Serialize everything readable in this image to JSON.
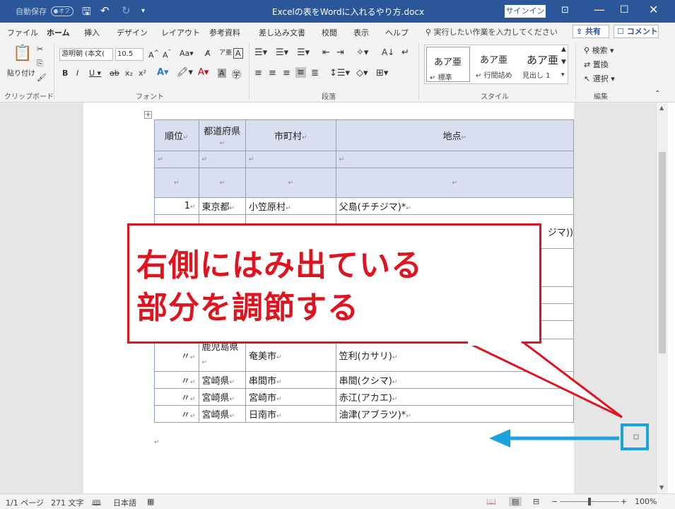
{
  "titlebar": {
    "autosave_label": "自動保存",
    "autosave_state": "オフ",
    "doc_title": "Excelの表をWordに入れるやり方.docx",
    "signin": "サインイン"
  },
  "tabs": [
    "ファイル",
    "ホーム",
    "挿入",
    "デザイン",
    "レイアウト",
    "参考資料",
    "差し込み文書",
    "校閲",
    "表示",
    "ヘルプ"
  ],
  "active_tab": "ホーム",
  "tellme": "実行したい作業を入力してください",
  "share": "共有",
  "comment": "コメント",
  "ribbon": {
    "clipboard": {
      "paste": "貼り付け",
      "label": "クリップボード"
    },
    "font": {
      "name": "游明朝 (本文(",
      "size": "10.5",
      "label": "フォント"
    },
    "paragraph": {
      "label": "段落"
    },
    "styles": {
      "label": "スタイル",
      "items": [
        {
          "preview": "あア亜",
          "name": "標準"
        },
        {
          "preview": "あア亜",
          "name": "行間詰め"
        },
        {
          "preview": "あア亜",
          "name": "見出し 1"
        }
      ]
    },
    "editing": {
      "find": "検索",
      "replace": "置換",
      "select": "選択",
      "label": "編集"
    }
  },
  "table": {
    "headers": [
      "順位",
      "都道府県",
      "市町村",
      "地点"
    ],
    "rows": [
      [
        "1",
        "東京都",
        "小笠原村",
        "父島(チチジマ)*"
      ],
      [
        "〃",
        "鹿児島県",
        "奄美市",
        "笠利(カサリ)"
      ],
      [
        "〃",
        "宮崎県",
        "串間市",
        "串間(クシマ)"
      ],
      [
        "〃",
        "宮崎県",
        "宮崎市",
        "赤江(アカエ)"
      ],
      [
        "〃",
        "宮崎県",
        "日南市",
        "油津(アブラツ)*"
      ]
    ],
    "partial_text": "ジマ))"
  },
  "callout": {
    "line1": "右側にはみ出ている",
    "line2": "部分を調節する"
  },
  "status": {
    "page": "1/1 ページ",
    "words": "271 文字",
    "language": "日本語",
    "zoom": "100%"
  },
  "colors": {
    "accent": "#2b579a",
    "callout_red": "#e0141e",
    "highlight_blue": "#1aa3e0"
  }
}
